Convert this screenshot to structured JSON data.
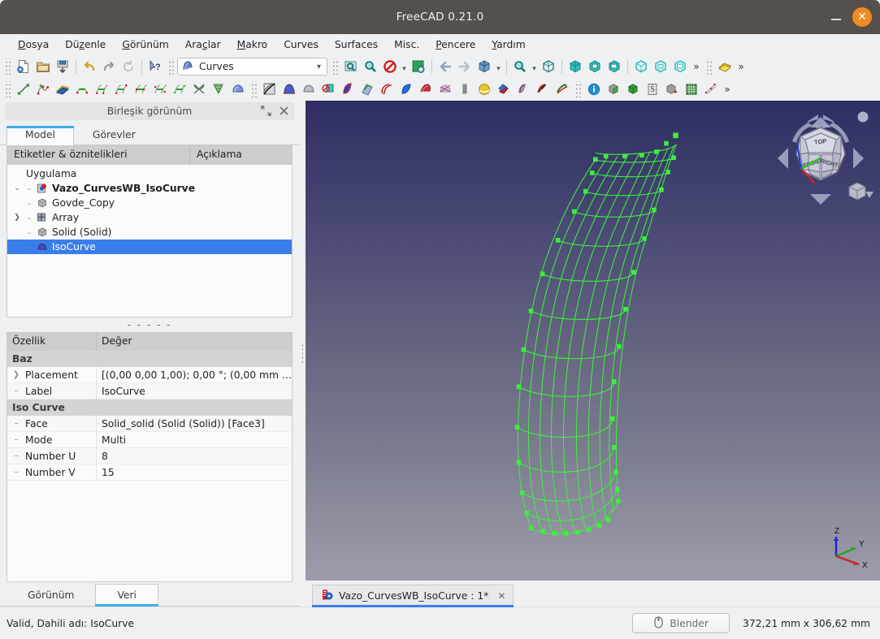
{
  "window": {
    "title": "FreeCAD 0.21.0",
    "minimize_label": "Minimize",
    "close_label": "✕"
  },
  "menubar": {
    "items": [
      {
        "label": "Dosya",
        "mnemonic": "D"
      },
      {
        "label": "Düzenle",
        "mnemonic": "z"
      },
      {
        "label": "Görünüm",
        "mnemonic": "G"
      },
      {
        "label": "Araçlar",
        "mnemonic": ""
      },
      {
        "label": "Makro",
        "mnemonic": "M"
      },
      {
        "label": "Curves",
        "mnemonic": ""
      },
      {
        "label": "Surfaces",
        "mnemonic": ""
      },
      {
        "label": "Misc.",
        "mnemonic": ""
      },
      {
        "label": "Pencere",
        "mnemonic": "P"
      },
      {
        "label": "Yardım",
        "mnemonic": "Y"
      }
    ]
  },
  "toolbar": {
    "workbench_selector": {
      "value": "Curves",
      "caret": "▾"
    },
    "overflow_label": "»",
    "file_group": [
      "new-document-icon",
      "open-document-icon",
      "save-document-icon"
    ],
    "edit_group": [
      "undo-icon",
      "redo-icon",
      "refresh-icon",
      "whats-this-icon"
    ],
    "view_group": [
      "fit-all-icon",
      "fit-selection-icon",
      "draw-style-icon",
      "toggle-axis-cross-icon"
    ],
    "nav_group": [
      "back-arrow-icon",
      "forward-arrow-icon",
      "isometric-view-icon",
      "zoom-icon",
      "view-fit-icon"
    ],
    "std_views": [
      "front-view-icon",
      "top-view-icon",
      "right-view-icon",
      "rear-view-icon",
      "bottom-view-icon",
      "left-view-icon"
    ],
    "curves_row": [
      "line-icon",
      "bspline-icon",
      "editable-spline-icon",
      "join-curve-icon",
      "discretize-icon",
      "approximate-icon",
      "interpolate-icon",
      "parametric-blend-icon",
      "blend-curve-icon",
      "curve-on-surface-icon",
      "isocurve-icon",
      "surface-patch-icon",
      "sketch-on-surface-icon",
      "pipeshell-icon",
      "gordon-surface-icon",
      "sweep2rails-icon",
      "profile-support-icon",
      "flatten-face-icon",
      "segment-surface-icon",
      "mixed-curve-icon",
      "curve-extend-icon",
      "hooked-surface-icon",
      "multi-loft-icon",
      "zebra-stripes-icon",
      "sphere-map-icon",
      "reflect-lines-icon",
      "comb-plot-icon",
      "deviation-icon",
      "info-icon",
      "solid-green-icon",
      "cube-green-icon",
      "clipboard-icon",
      "shape-info-icon",
      "grid-icon",
      "nurbs-points-icon"
    ]
  },
  "left_dock": {
    "title": "Birleşik görünüm",
    "float_icon": "↗↙",
    "close_icon": "✕",
    "tabs": [
      {
        "label": "Model",
        "active": true
      },
      {
        "label": "Görevler",
        "active": false
      }
    ],
    "tree": {
      "columns": [
        "Etiketler & öznitelikleri",
        "Açıklama"
      ],
      "root_label": "Uygulama",
      "nodes": [
        {
          "label": "Vazo_CurvesWB_IsoCurve",
          "icon": "document-icon",
          "depth": 1,
          "expander": "expanded",
          "bold": true,
          "selected": false
        },
        {
          "label": "Govde_Copy",
          "icon": "solid-box-icon",
          "depth": 2,
          "expander": "none",
          "bold": false,
          "selected": false
        },
        {
          "label": "Array",
          "icon": "array-icon",
          "depth": 2,
          "expander": "collapsed",
          "bold": false,
          "selected": false
        },
        {
          "label": "Solid (Solid)",
          "icon": "solid-box-icon",
          "depth": 2,
          "expander": "none",
          "bold": false,
          "selected": false
        },
        {
          "label": "IsoCurve",
          "icon": "isocurve-icon",
          "depth": 2,
          "expander": "none",
          "bold": false,
          "selected": true
        }
      ]
    },
    "splitter_handle": "- - - - -",
    "properties": {
      "columns": [
        "Özellik",
        "Değer"
      ],
      "groups": [
        {
          "name": "Baz",
          "rows": [
            {
              "name": "Placement",
              "value": "[(0,00 0,00 1,00); 0,00 °; (0,00 mm  …",
              "expander": "collapsed"
            },
            {
              "name": "Label",
              "value": "IsoCurve",
              "expander": "leaf"
            }
          ]
        },
        {
          "name": "Iso Curve",
          "rows": [
            {
              "name": "Face",
              "value": "Solid_solid (Solid (Solid)) [Face3]",
              "expander": "leaf"
            },
            {
              "name": "Mode",
              "value": "Multi",
              "expander": "leaf"
            },
            {
              "name": "Number U",
              "value": "8",
              "expander": "leaf"
            },
            {
              "name": "Number V",
              "value": "15",
              "expander": "leaf"
            }
          ]
        }
      ]
    },
    "bottom_tabs": [
      {
        "label": "Görünüm",
        "active": false
      },
      {
        "label": "Veri",
        "active": true
      }
    ]
  },
  "viewport": {
    "navcube": {
      "faces": [
        "TOP",
        "FRONT",
        "RIGHT"
      ],
      "corner_dot": "home-dot",
      "arrows": [
        "rotate-left-arrow",
        "rotate-right-arrow",
        "up-arrow",
        "down-arrow",
        "left-arrow",
        "right-arrow"
      ],
      "cube_menu_caret": "▾"
    },
    "axis_cross": {
      "x_label": "X",
      "y_label": "Y",
      "z_label": "Z",
      "x_color": "#cc2222",
      "y_color": "#22aa22",
      "z_color": "#2222cc"
    },
    "model": {
      "name": "IsoCurve wireframe",
      "color": "#3cf03c",
      "u_lines": 8,
      "v_lines": 15
    },
    "background_top": "#2e2e63",
    "background_bottom": "#9c9cab"
  },
  "mdi": {
    "tabs": [
      {
        "label": "Vazo_CurvesWB_IsoCurve : 1*",
        "icon": "freecad-document-icon",
        "close": "✕",
        "active": true
      }
    ]
  },
  "statusbar": {
    "message": "Valid, Dahili adı: IsoCurve",
    "blender_button": {
      "label": "Blender",
      "icon": "mouse-navigation-icon"
    },
    "dimensions": "372,21 mm x 306,62 mm"
  }
}
